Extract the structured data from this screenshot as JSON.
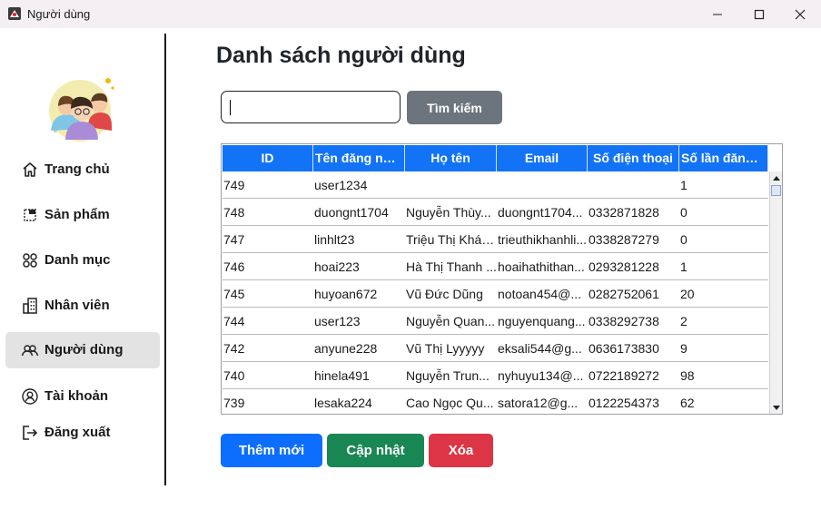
{
  "window": {
    "title": "Người dùng"
  },
  "sidebar": {
    "items": [
      {
        "label": "Trang chủ",
        "icon": "home-icon"
      },
      {
        "label": "Sản phẩm",
        "icon": "product-icon"
      },
      {
        "label": "Danh mục",
        "icon": "category-icon"
      },
      {
        "label": "Nhân viên",
        "icon": "building-icon"
      },
      {
        "label": "Người dùng",
        "icon": "users-icon",
        "active": true
      },
      {
        "label": "Tài khoản",
        "icon": "account-icon"
      },
      {
        "label": "Đăng xuất",
        "icon": "logout-icon"
      }
    ]
  },
  "main": {
    "title": "Danh sách người dùng",
    "search": {
      "value": "",
      "button": "Tìm kiếm"
    },
    "table": {
      "columns": [
        "ID",
        "Tên đăng nhập",
        "Họ tên",
        "Email",
        "Số điện thoại",
        "Số lần đăng n..."
      ],
      "rows": [
        [
          "749",
          "user1234",
          "",
          "",
          "",
          "1"
        ],
        [
          "748",
          "duongnt1704",
          "Nguyễn Thùy...",
          "duongnt1704...",
          "0332871828",
          "0"
        ],
        [
          "747",
          "linhlt23",
          "Triệu Thị Khán...",
          "trieuthikhanhli...",
          "0338287279",
          "0"
        ],
        [
          "746",
          "hoai223",
          "Hà Thị Thanh ...",
          "hoaihathithan...",
          "0293281228",
          "1"
        ],
        [
          "745",
          "huyoan672",
          "Vũ Đức Dũng",
          "notoan454@...",
          "0282752061",
          "20"
        ],
        [
          "744",
          "user123",
          "Nguyễn Quan...",
          "nguyenquang...",
          "0338292738",
          "2"
        ],
        [
          "742",
          "anyune228",
          "Vũ Thị Lyyyyy",
          "eksali544@g...",
          "0636173830",
          "9"
        ],
        [
          "740",
          "hinela491",
          "Nguyễn Trun...",
          "nyhuyu134@...",
          "0722189272",
          "98"
        ],
        [
          "739",
          "lesaka224",
          "Cao Ngọc Qu...",
          "satora12@g...",
          "0122254373",
          "62"
        ]
      ]
    },
    "actions": {
      "add": "Thêm mới",
      "update": "Cập nhật",
      "delete": "Xóa"
    }
  },
  "colors": {
    "header": "#1273f7",
    "add": "#0d6efd",
    "update": "#198754",
    "delete": "#dc3545",
    "search": "#6c757d"
  }
}
